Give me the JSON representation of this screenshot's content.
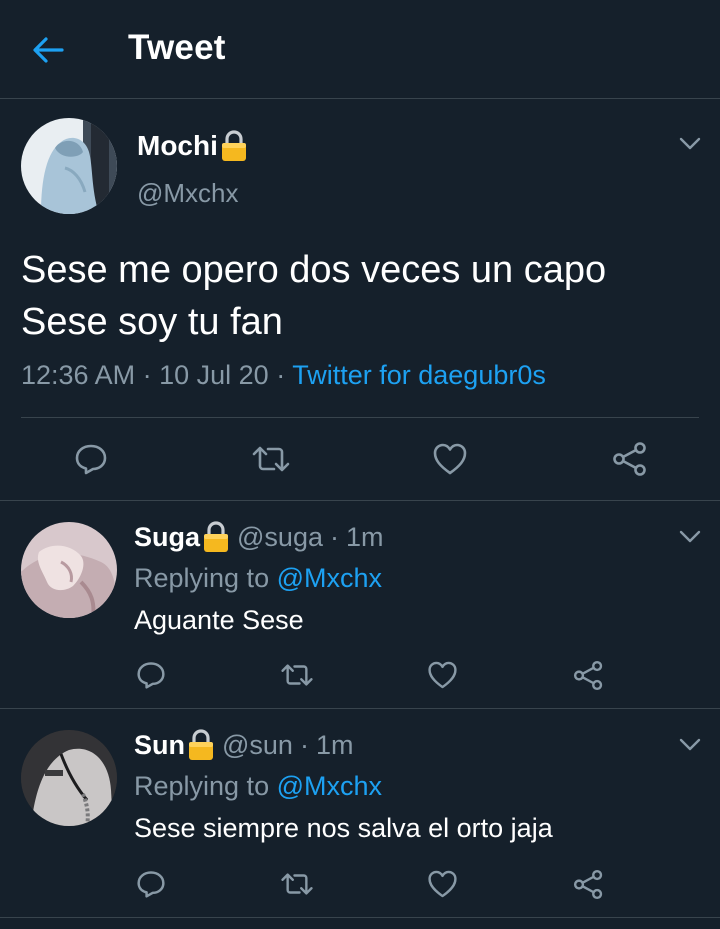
{
  "header": {
    "title": "Tweet"
  },
  "main_tweet": {
    "name": "Mochi",
    "handle": "@Mxchx",
    "text_line1": "Sese me opero dos veces un capo",
    "text_line2": "Sese soy tu fan",
    "time": "12:36 AM",
    "date": "10 Jul 20",
    "separator": "·",
    "source": "Twitter for daegubr0s"
  },
  "replies": [
    {
      "name": "Suga",
      "handle": "@suga",
      "separator": "·",
      "time": "1m",
      "replying_prefix": "Replying to",
      "replying_to": "@Mxchx",
      "text": "Aguante Sese"
    },
    {
      "name": "Sun",
      "handle": "@sun",
      "separator": "·",
      "time": "1m",
      "replying_prefix": "Replying to",
      "replying_to": "@Mxchx",
      "text": "Sese siempre nos salva el orto jaja"
    }
  ],
  "colors": {
    "background": "#15202b",
    "divider": "#38444d",
    "secondary_text": "#8899a6",
    "accent": "#1da1f2"
  },
  "icons": [
    "back-arrow-icon",
    "lock-icon",
    "chevron-down-icon",
    "reply-icon",
    "retweet-icon",
    "like-icon",
    "share-icon"
  ]
}
